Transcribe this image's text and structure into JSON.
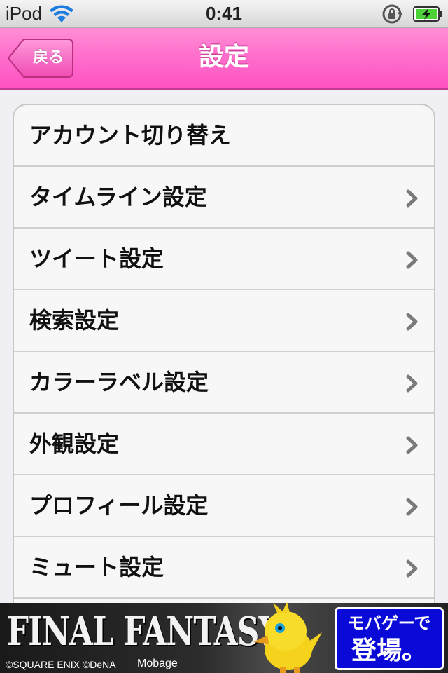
{
  "status_bar": {
    "carrier": "iPod",
    "time": "0:41",
    "icons": [
      "wifi-icon",
      "rotation-lock-icon",
      "battery-charging-icon"
    ]
  },
  "nav": {
    "back_label": "戻る",
    "title": "設定"
  },
  "settings": {
    "items": [
      {
        "label": "アカウント切り替え",
        "chevron": false
      },
      {
        "label": "タイムライン設定",
        "chevron": true
      },
      {
        "label": "ツイート設定",
        "chevron": true
      },
      {
        "label": "検索設定",
        "chevron": true
      },
      {
        "label": "カラーラベル設定",
        "chevron": true
      },
      {
        "label": "外観設定",
        "chevron": true
      },
      {
        "label": "プロフィール設定",
        "chevron": true
      },
      {
        "label": "ミュート設定",
        "chevron": true
      }
    ]
  },
  "ad": {
    "headline": "FINAL FANTASY",
    "credit": "©SQUARE ENIX ©DeNA",
    "brand": "Mobage",
    "cta_top": "モバゲーで",
    "cta_bottom": "登場。"
  },
  "colors": {
    "nav_pink": "#ff6fcc",
    "ad_blue": "#0a0ad8"
  }
}
